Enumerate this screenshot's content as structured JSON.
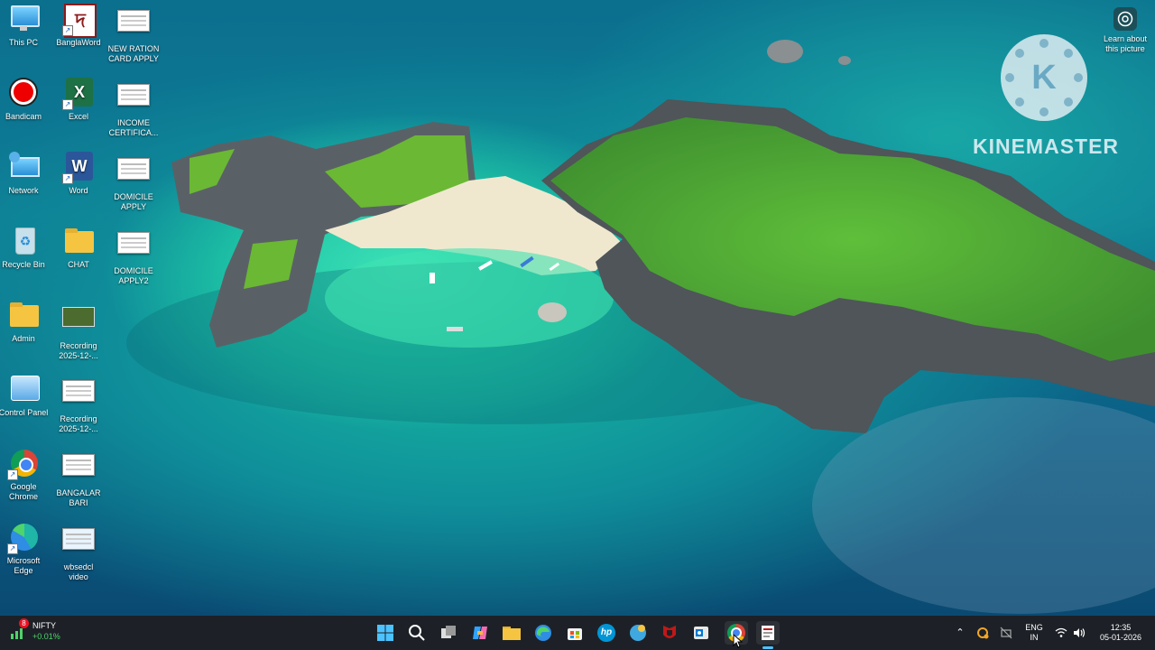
{
  "desktop": {
    "icons": [
      {
        "name": "this-pc",
        "label": "This PC"
      },
      {
        "name": "banglaword",
        "label": "BanglaWord"
      },
      {
        "name": "new-ration",
        "label": "NEW RATION\nCARD APPLY"
      },
      {
        "name": "bandicam",
        "label": "Bandicam"
      },
      {
        "name": "excel",
        "label": "Excel"
      },
      {
        "name": "income",
        "label": "INCOME\nCERTIFICA..."
      },
      {
        "name": "network",
        "label": "Network"
      },
      {
        "name": "word",
        "label": "Word"
      },
      {
        "name": "domicile-apply",
        "label": "DOMICILE\nAPPLY"
      },
      {
        "name": "recycle-bin",
        "label": "Recycle Bin"
      },
      {
        "name": "chat",
        "label": "CHAT"
      },
      {
        "name": "domicile-apply-v2",
        "label": "DOMICILE\nAPPLY2"
      },
      {
        "name": "admin",
        "label": "Admin"
      },
      {
        "name": "recording-1",
        "label": "Recording\n2025-12-..."
      },
      {
        "name": "control-panel",
        "label": "Control Panel"
      },
      {
        "name": "recording-2",
        "label": "Recording\n2025-12-..."
      },
      {
        "name": "google-chrome",
        "label": "Google\nChrome"
      },
      {
        "name": "bangalar-bari",
        "label": "BANGALAR\nBARI"
      },
      {
        "name": "microsoft-edge",
        "label": "Microsoft\nEdge"
      },
      {
        "name": "wbsedcl-video",
        "label": "wbsedcl\nvideo"
      }
    ],
    "learn_label": "Learn about\nthis picture",
    "watermark": "KINEMASTER",
    "watermark_letter": "K"
  },
  "taskbar": {
    "widget": {
      "badge": "8",
      "title": "NIFTY",
      "change": "+0.01%"
    },
    "apps": [
      "start-icon",
      "search-icon",
      "task-view-icon",
      "copilot-icon",
      "file-explorer-icon",
      "edge-icon",
      "store-icon",
      "hp-icon",
      "browser-icon",
      "mcafee-icon",
      "outlook-icon",
      "chrome-icon",
      "document-app-icon"
    ],
    "hp_text": "hp",
    "tray": {
      "lang1": "ENG",
      "lang2": "IN",
      "time": "12:35",
      "date": "05-01-2026"
    }
  },
  "colors": {
    "taskbar": "#1d2127",
    "accent": "#0078d4",
    "nifty_change": "#4fd36b"
  }
}
